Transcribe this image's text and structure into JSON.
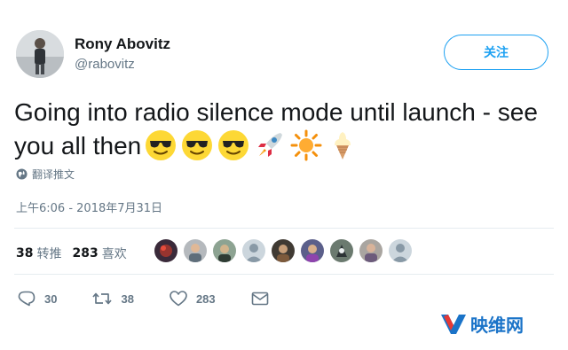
{
  "user": {
    "name": "Rony Abovitz",
    "handle": "@rabovitz"
  },
  "follow_button": {
    "label": "关注"
  },
  "tweet": {
    "text": "Going into radio silence mode until launch - see you all then",
    "emojis": [
      "sunglasses-emoji",
      "sunglasses-emoji",
      "sunglasses-emoji",
      "rocket-emoji",
      "sun-emoji",
      "ice-cream-emoji"
    ]
  },
  "translate": {
    "label": "翻译推文"
  },
  "timestamp": "上午6:06 - 2018年7月31日",
  "stats": {
    "retweets_count": "38",
    "retweets_label": "转推",
    "likes_count": "283",
    "likes_label": "喜欢"
  },
  "actions": {
    "reply_count": "30",
    "retweet_count": "38",
    "like_count": "283"
  },
  "watermark": {
    "text": "映维网"
  },
  "colors": {
    "accent": "#1da1f2",
    "secondary_text": "#657786",
    "divider": "#e6ecf0",
    "watermark": "#1a73c8"
  }
}
